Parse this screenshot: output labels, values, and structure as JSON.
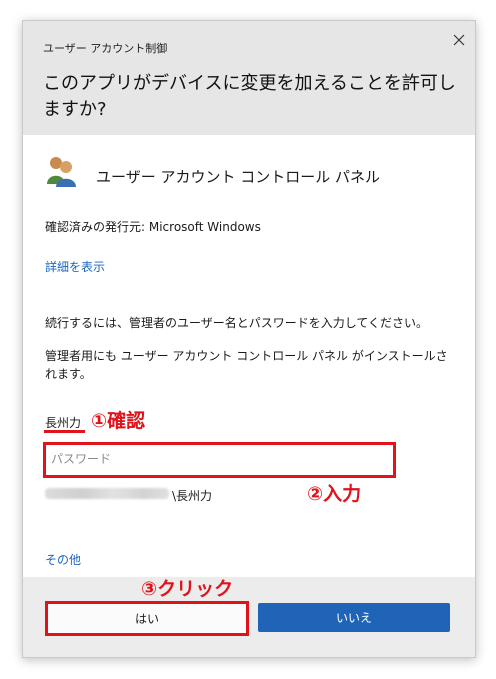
{
  "dialog": {
    "caption": "ユーザー アカウント制御",
    "question": "このアプリがデバイスに変更を加えることを許可しますか?",
    "app_name": "ユーザー アカウント コントロール パネル",
    "publisher": "確認済みの発行元: Microsoft Windows",
    "details_link": "詳細を表示",
    "prompt_line1": "続行するには、管理者のユーザー名とパスワードを入力してください。",
    "prompt_line2": "管理者用にも ユーザー アカウント コントロール パネル がインストールされます。",
    "user_name": "長州力",
    "password_placeholder": "パスワード",
    "domain_user_suffix": "\\長州力",
    "more_options_link": "その他",
    "yes_button": "はい",
    "no_button": "いいえ",
    "icons": [
      "close-icon",
      "users-icon"
    ]
  },
  "annotations": {
    "step1": "①確認",
    "step2": "②入力",
    "step3": "③クリック",
    "color": "#e0131a"
  },
  "colors": {
    "header_bg": "#e6e6e6",
    "link": "#1a66c0",
    "primary_button": "#1f64b7"
  }
}
